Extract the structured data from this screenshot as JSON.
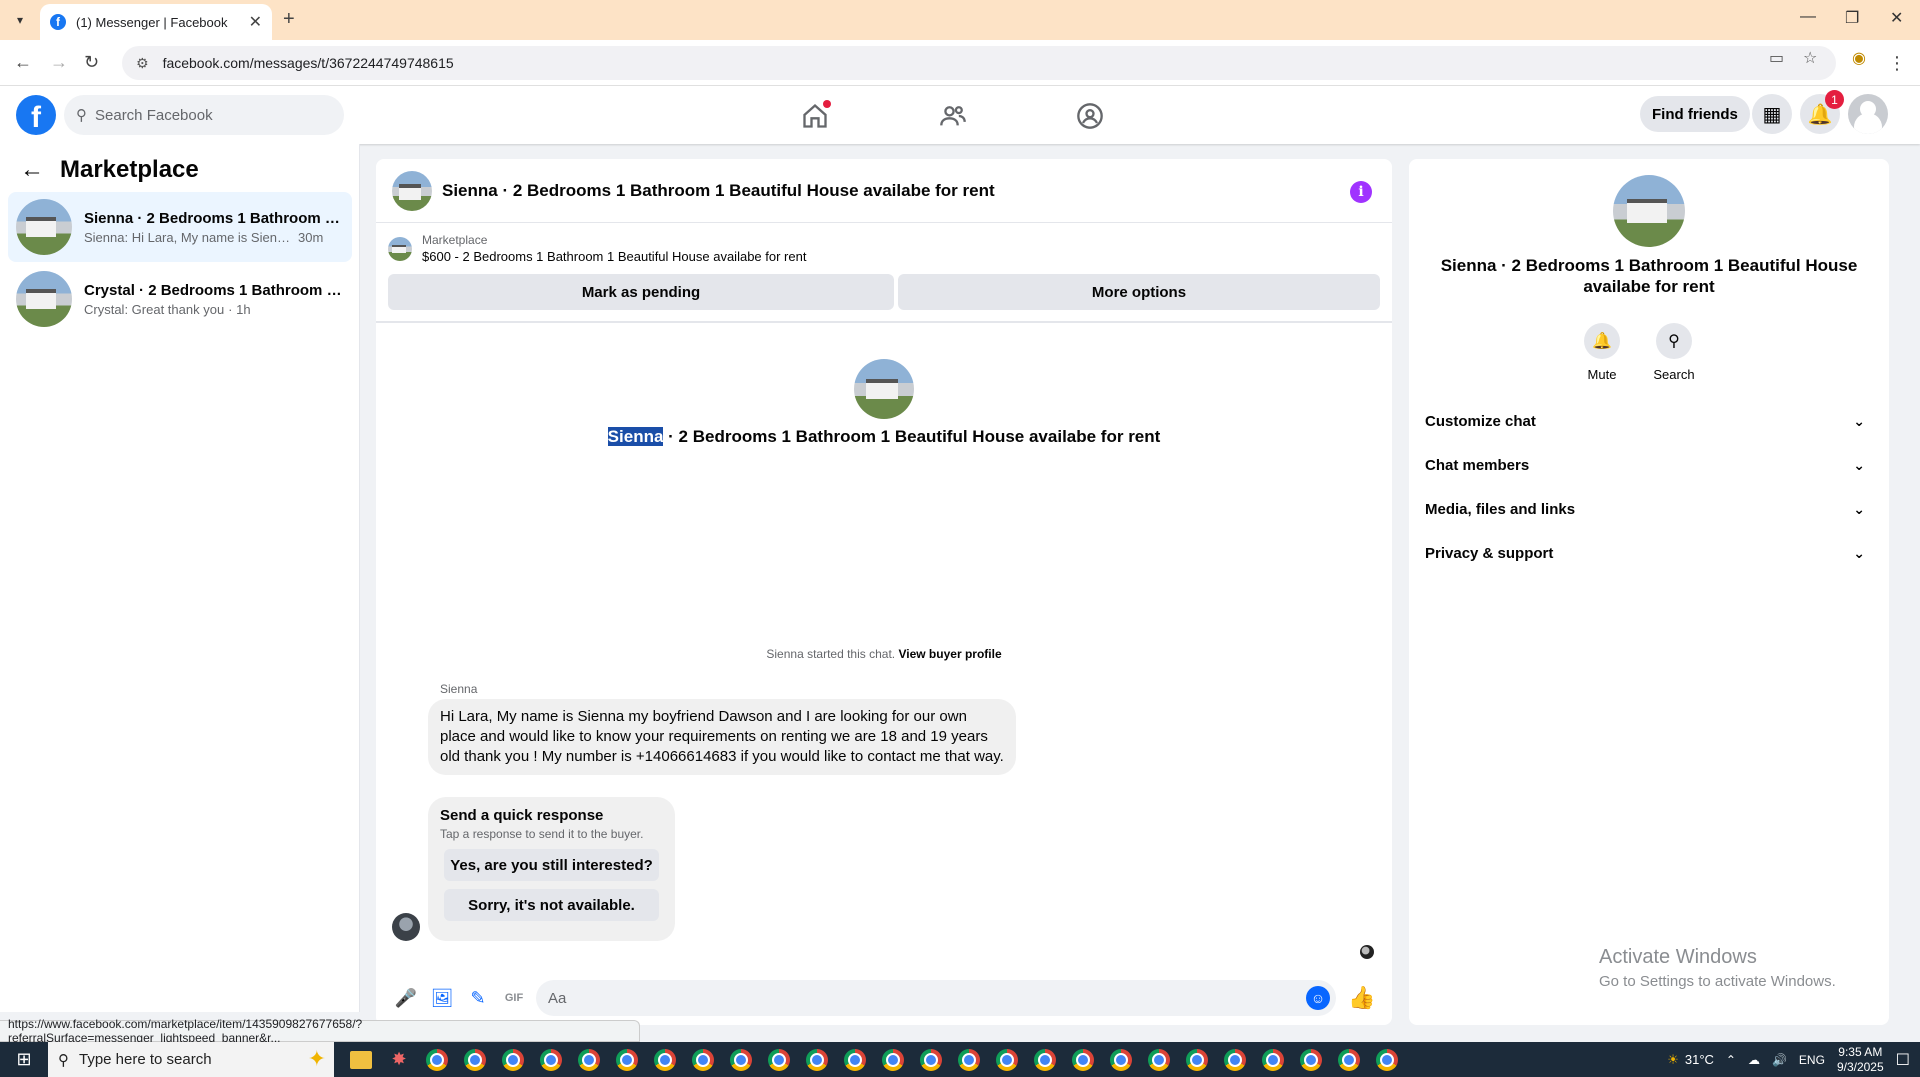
{
  "browser": {
    "tab_title": "(1) Messenger | Facebook",
    "url": "facebook.com/messages/t/3672244749748615",
    "status_url": "https://www.facebook.com/marketplace/item/1435909827677658/?referralSurface=messenger_lightspeed_banner&r..."
  },
  "fb": {
    "search_placeholder": "Search Facebook",
    "find_friends": "Find friends",
    "notification_count": "1"
  },
  "sidebar": {
    "title": "Marketplace",
    "conversations": [
      {
        "name": "Sienna · 2 Bedrooms 1 Bathroom 1 ...",
        "snippet": "Sienna: Hi Lara, My name is Sienna ...",
        "time": "30m"
      },
      {
        "name": "Crystal · 2 Bedrooms 1 Bathroom 1...",
        "snippet": "Crystal: Great thank you",
        "time": "· 1h"
      }
    ]
  },
  "chat": {
    "title": "Sienna · 2 Bedrooms 1 Bathroom 1 Beautiful House availabe for rent",
    "marketplace_label": "Marketplace",
    "listing": "$600 - 2 Bedrooms 1 Bathroom 1 Beautiful House availabe for rent",
    "mark_pending": "Mark as pending",
    "more_options": "More options",
    "center_name": "Sienna",
    "center_rest": " · 2 Bedrooms 1 Bathroom 1 Beautiful House availabe for rent",
    "started_text": "Sienna started this chat.",
    "view_profile": "View buyer profile",
    "sender": "Sienna",
    "message": "Hi Lara, My name is Sienna  my boyfriend Dawson and I are looking for our own place and would like to know your requirements on renting we are 18 and 19 years old thank you ! My number is +14066614683 if you would like to contact me that way.",
    "quick_title": "Send a quick response",
    "quick_sub": "Tap a response to send it to the buyer.",
    "quick_1": "Yes, are you still interested?",
    "quick_2": "Sorry, it's not available.",
    "composer_placeholder": "Aa"
  },
  "info": {
    "title": "Sienna · 2 Bedrooms 1 Bathroom 1 Beautiful House availabe for rent",
    "mute": "Mute",
    "search": "Search",
    "rows": [
      "Customize chat",
      "Chat members",
      "Media, files and links",
      "Privacy & support"
    ]
  },
  "watermark": {
    "title": "Activate Windows",
    "sub": "Go to Settings to activate Windows."
  },
  "taskbar": {
    "search_placeholder": "Type here to search",
    "temperature": "31°C",
    "language": "ENG",
    "time": "9:35 AM",
    "date": "9/3/2025"
  }
}
